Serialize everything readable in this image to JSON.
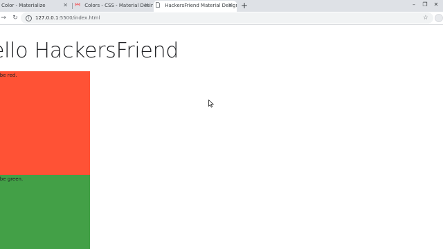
{
  "browser": {
    "tabs": [
      {
        "label": "Color - Materialize",
        "active": false,
        "favicon": "blank-icon"
      },
      {
        "label": "Colors - CSS - Material Desing T",
        "active": false,
        "favicon": "materialize-icon"
      },
      {
        "label": "HackersFriend Material Design",
        "active": true,
        "favicon": "document-icon"
      }
    ],
    "new_tab_label": "+",
    "url": {
      "host": "127.0.0.1",
      "path": ":5500/index.html"
    }
  },
  "page": {
    "heading": "ello HackersFriend",
    "boxes": [
      {
        "text": "will be red.",
        "color": "#ff5235"
      },
      {
        "text": "will be green.",
        "color": "#43a047"
      }
    ]
  },
  "colors": {
    "tabstrip": "#dee1e6",
    "red_box": "#ff5235",
    "green_box": "#43a047"
  }
}
